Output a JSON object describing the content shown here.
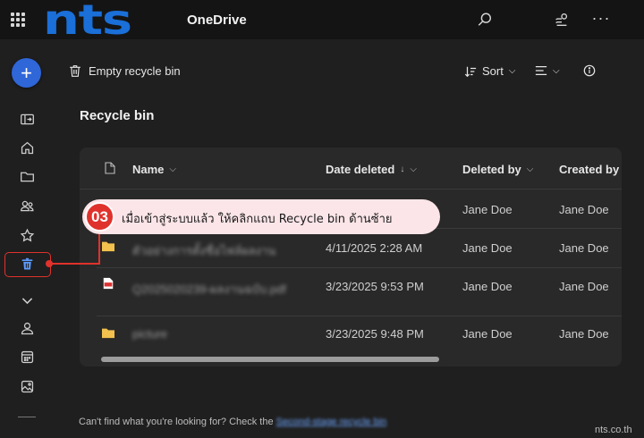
{
  "app": {
    "logo_text": "nts",
    "name": "OneDrive"
  },
  "toolbar": {
    "empty_bin_label": "Empty recycle bin",
    "sort_label": "Sort"
  },
  "page": {
    "title": "Recycle bin"
  },
  "table": {
    "columns": [
      "Name",
      "Date deleted",
      "Deleted by",
      "Created by"
    ],
    "sort_arrow": "↓",
    "rows": [
      {
        "type": "folder",
        "name": "",
        "date_deleted": "",
        "deleted_by": "Jane Doe",
        "created_by": "Jane Doe"
      },
      {
        "type": "folder",
        "name": "ตัวอย่างการตั้งชื่อไฟล์ผลงาน",
        "date_deleted": "4/11/2025 2:28 AM",
        "deleted_by": "Jane Doe",
        "created_by": "Jane Doe"
      },
      {
        "type": "pdf",
        "name": "Q2025020239-ผลงานฉบับ.pdf",
        "date_deleted": "3/23/2025 9:53 PM",
        "deleted_by": "Jane Doe",
        "created_by": "Jane Doe"
      },
      {
        "type": "folder",
        "name": "picture",
        "date_deleted": "3/23/2025 9:48 PM",
        "deleted_by": "Jane Doe",
        "created_by": "Jane Doe"
      }
    ]
  },
  "callout": {
    "step": "03",
    "text": "เมื่อเข้าสู่ระบบแล้ว ให้คลิกแถบ Recycle bin ด้านซ้าย"
  },
  "footer": {
    "text": "Can't find what you're looking for? Check the",
    "link": "Second-stage recycle bin"
  },
  "watermark": "nts.co.th",
  "colors": {
    "accent": "#2f66d8",
    "logo": "#1a6fd8",
    "callout_red": "#e0322c",
    "callout_bg": "#fbe5e8",
    "folder": "#f2c14e"
  },
  "icons": {
    "top": [
      "waffle-icon",
      "search-icon",
      "premium-icon",
      "more-icon"
    ],
    "rail": [
      "add-icon",
      "expand-icon",
      "home-icon",
      "folder-icon",
      "shared-icon",
      "star-icon",
      "recycle-bin-icon",
      "chevron-down-icon",
      "people-icon",
      "calendar-icon",
      "photos-icon"
    ]
  }
}
